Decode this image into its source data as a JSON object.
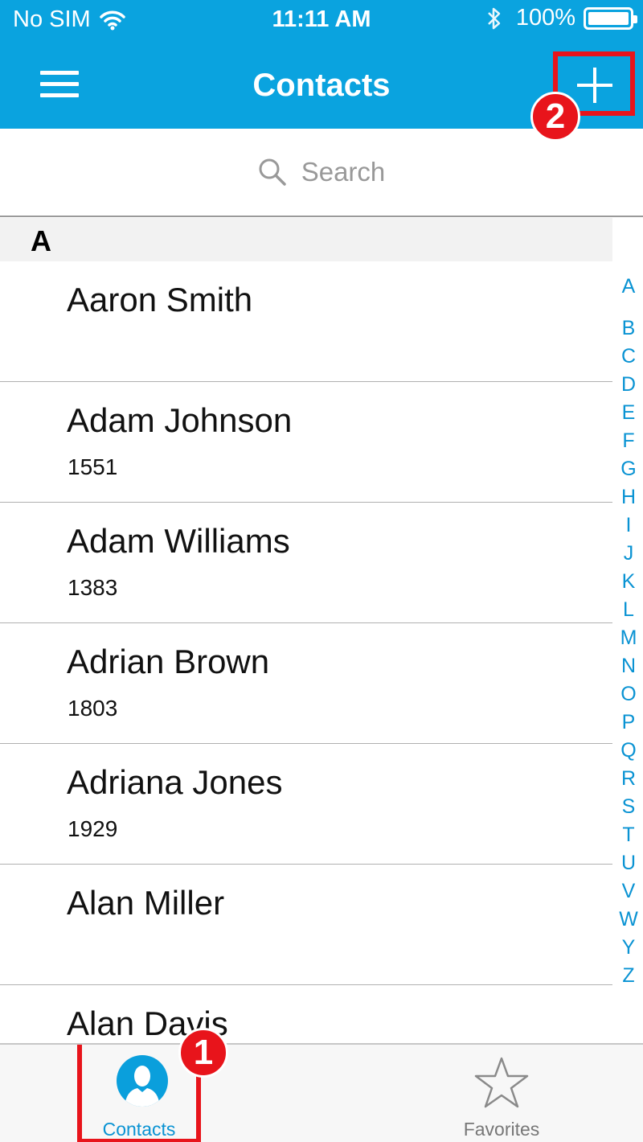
{
  "status_bar": {
    "carrier": "No SIM",
    "time": "11:11 AM",
    "battery": "100%"
  },
  "nav": {
    "title": "Contacts",
    "menu_icon": "hamburger-icon",
    "add_icon": "plus-icon"
  },
  "search": {
    "placeholder": "Search",
    "icon": "search-icon"
  },
  "section": {
    "letter": "A"
  },
  "contacts": [
    {
      "name": "Aaron Smith",
      "number": ""
    },
    {
      "name": "Adam Johnson",
      "number": "1551"
    },
    {
      "name": "Adam Williams",
      "number": "1383"
    },
    {
      "name": "Adrian Brown",
      "number": "1803"
    },
    {
      "name": "Adriana Jones",
      "number": "1929"
    },
    {
      "name": "Alan Miller",
      "number": ""
    },
    {
      "name": "Alan Davis",
      "number": ""
    }
  ],
  "alphabet_index": [
    "A",
    "B",
    "C",
    "D",
    "E",
    "F",
    "G",
    "H",
    "I",
    "J",
    "K",
    "L",
    "M",
    "N",
    "O",
    "P",
    "Q",
    "R",
    "S",
    "T",
    "U",
    "V",
    "W",
    "Y",
    "Z"
  ],
  "tabbar": {
    "contacts_label": "Contacts",
    "favorites_label": "Favorites"
  },
  "annotations": {
    "badge_1": "1",
    "badge_2": "2"
  },
  "colors": {
    "header": "#0aa3df",
    "accent": "#0a93d3",
    "highlight": "#e8141b"
  }
}
